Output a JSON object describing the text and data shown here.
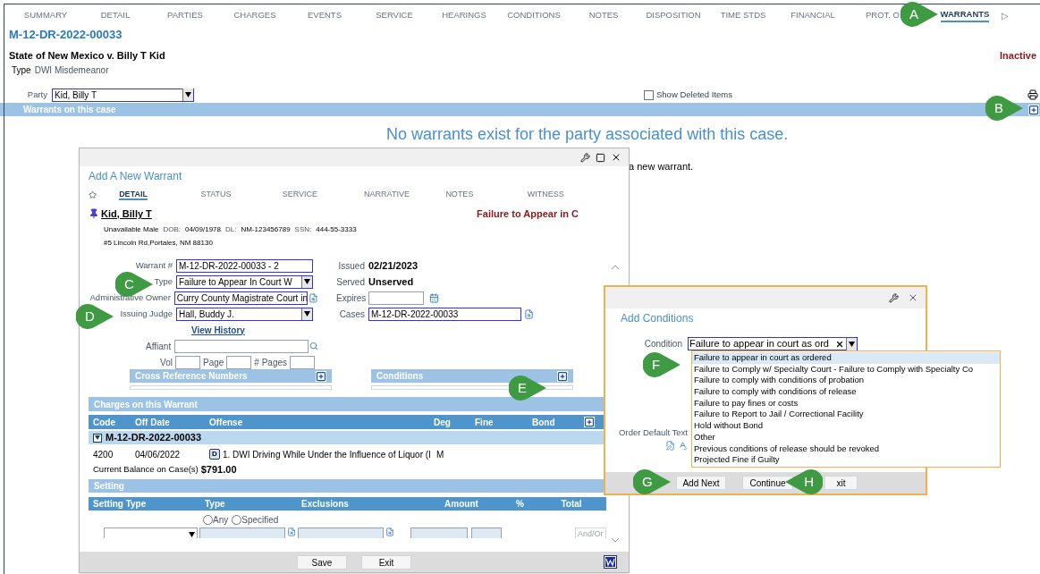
{
  "tabs": [
    {
      "label": "SUMMARY",
      "selected": false
    },
    {
      "label": "DETAIL",
      "selected": false
    },
    {
      "label": "PARTIES",
      "selected": false
    },
    {
      "label": "CHARGES",
      "selected": false
    },
    {
      "label": "EVENTS",
      "selected": false
    },
    {
      "label": "SERVICE",
      "selected": false
    },
    {
      "label": "HEARINGS",
      "selected": false
    },
    {
      "label": "CONDITIONS",
      "selected": false
    },
    {
      "label": "NOTES",
      "selected": false
    },
    {
      "label": "DISPOSITION",
      "selected": false
    },
    {
      "label": "TIME STDS",
      "selected": false
    },
    {
      "label": "FINANCIAL",
      "selected": false
    },
    {
      "label": "PROT. O",
      "selected": false
    },
    {
      "label": "WARRANTS",
      "selected": true
    }
  ],
  "tabs_more": "▷",
  "case_number": "M-12-DR-2022-00033",
  "case_title": "State of New Mexico v. Billy T Kid",
  "case_status": "Inactive",
  "case_type": {
    "label": "Type",
    "value": "DWI Misdemeanor"
  },
  "party": {
    "label": "Party",
    "value": "Kid, Billy T"
  },
  "show_deleted": {
    "label": "Show Deleted Items",
    "checked": false
  },
  "warrants_bar": {
    "title": "Warrants on this case"
  },
  "empty_message": "No warrants exist for the party associated with this case.",
  "hidden_hint": "a new warrant.",
  "warrant_dialog": {
    "title": "Add A New Warrant",
    "tabs": [
      {
        "label": "DETAIL",
        "selected": true
      },
      {
        "label": "STATUS",
        "selected": false
      },
      {
        "label": "SERVICE",
        "selected": false
      },
      {
        "label": "NARRATIVE",
        "selected": false
      },
      {
        "label": "NOTES",
        "selected": false
      },
      {
        "label": "WITNESS",
        "selected": false
      }
    ],
    "person": {
      "name": "Kid, Billy T",
      "warrant_type": "Failure to Appear in C",
      "description": "Unavailable Male",
      "dob_label": "DOB:",
      "dob": "04/09/1978",
      "dl_label": "DL:",
      "dl": "NM-123456789",
      "ssn_label": "SSN:",
      "ssn": "444-55-3333",
      "address": "#5 Lincoln Rd,Portales, NM 88130"
    },
    "fields": [
      {
        "label": "Warrant #",
        "value": "M-12-DR-2022-00033 - 2",
        "kind": "text"
      },
      {
        "label": "Type",
        "value": "Failure to Appear In Court W",
        "kind": "select"
      },
      {
        "label": "Administrative Owner",
        "value": "Curry County Magistrate Court in",
        "kind": "lookup"
      },
      {
        "label": "Issuing Judge",
        "value": "Hall, Buddy J.",
        "kind": "select"
      }
    ],
    "view_history": "View History",
    "affiant_label": "Affiant",
    "vol_label": "Vol",
    "page_label": "Page",
    "pages_label": "# Pages",
    "status_fields": [
      {
        "label": "Issued",
        "value": "02/21/2023"
      },
      {
        "label": "Served",
        "value": "Unserved"
      }
    ],
    "expires_label": "Expires",
    "cases": {
      "label": "Cases",
      "value": "M-12-DR-2022-00033"
    },
    "sections": [
      "Cross Reference Numbers",
      "Conditions"
    ],
    "charges": {
      "title": "Charges on this Warrant",
      "columns": [
        "Code",
        "Off Date",
        "Offense",
        "Deg",
        "Fine",
        "Bond"
      ],
      "group": {
        "case": "M-12-DR-2022-00033",
        "expanded": true
      },
      "rows": [
        {
          "code": "4200",
          "off_date": "04/06/2022",
          "badge": "D",
          "offense": "1. DWI Driving While Under the Influence of Liquor (I",
          "deg": "M"
        }
      ],
      "balance_label": "Current Balance on Case(s)",
      "balance": "$791.00"
    },
    "setting": {
      "title": "Setting",
      "columns": [
        "Setting Type",
        "Type",
        "Exclusions",
        "Amount",
        "%",
        "Total"
      ],
      "options": [
        {
          "label": "Any",
          "selected": false
        },
        {
          "label": "Specified",
          "selected": false
        }
      ],
      "and_or": "And/Or"
    },
    "buttons": [
      "Save",
      "Exit"
    ]
  },
  "conditions_dialog": {
    "title": "Add Conditions",
    "condition": {
      "label": "Condition",
      "value": "Failure to appear in court as ord"
    },
    "options": [
      {
        "label": "Failure to appear in court as ordered",
        "selected": true
      },
      {
        "label": "Failure to Comply w/ Specialty Court - Failure to Comply with Specialty Co",
        "selected": false
      },
      {
        "label": "Failure to comply with conditions of probation",
        "selected": false
      },
      {
        "label": "Failure to comply with conditions of release",
        "selected": false
      },
      {
        "label": "Failure to pay fines or costs",
        "selected": false
      },
      {
        "label": "Failure to Report to Jail / Correctional Facility",
        "selected": false
      },
      {
        "label": "Hold without Bond",
        "selected": false
      },
      {
        "label": "Other",
        "selected": false
      },
      {
        "label": "Previous conditions of release should be revoked",
        "selected": false
      },
      {
        "label": "Projected Fine if Guilty",
        "selected": false
      }
    ],
    "order_text_label": "Order Default Text",
    "buttons": [
      "Add Next",
      "Continue",
      "xit"
    ]
  },
  "callouts": [
    "A",
    "B",
    "C",
    "D",
    "E",
    "F",
    "G",
    "H"
  ]
}
